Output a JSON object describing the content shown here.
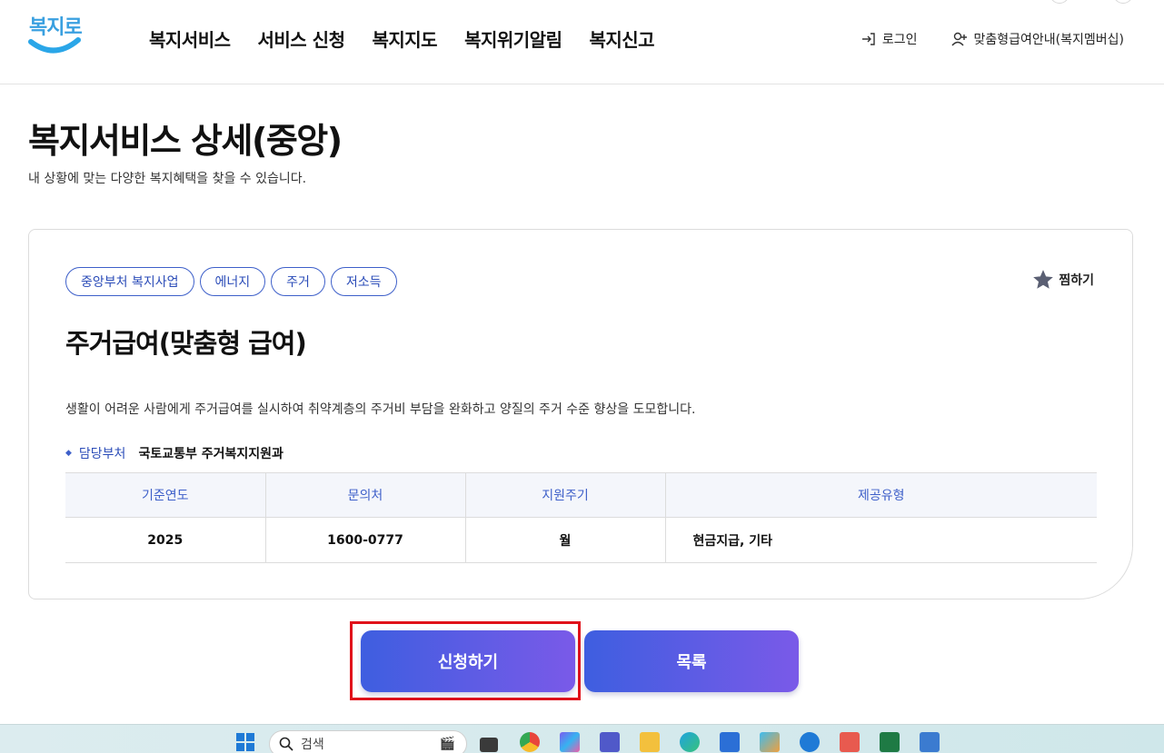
{
  "header": {
    "logo_text": "복지로",
    "nav": [
      "복지서비스",
      "서비스 신청",
      "복지지도",
      "복지위기알림",
      "복지신고"
    ],
    "login_label": "로그인",
    "membership_label": "맞춤형급여안내(복지멤버십)"
  },
  "page": {
    "title": "복지서비스 상세(중앙)",
    "subtitle": "내 상황에 맞는 다양한 복지혜택을 찾을 수 있습니다."
  },
  "service": {
    "tags": [
      "중앙부처 복지사업",
      "에너지",
      "주거",
      "저소득"
    ],
    "favorite_label": "찜하기",
    "title": "주거급여(맞춤형 급여)",
    "description": "생활이 어려운 사람에게 주거급여를 실시하여 취약계층의 주거비 부담을 완화하고 양질의 주거 수준 향상을 도모합니다.",
    "dept_label": "담당부처",
    "dept_value": "국토교통부 주거복지지원과",
    "table": {
      "headers": [
        "기준연도",
        "문의처",
        "지원주기",
        "제공유형"
      ],
      "row": [
        "2025",
        "1600-0777",
        "월",
        "현금지급, 기타"
      ]
    }
  },
  "buttons": {
    "apply": "신청하기",
    "list": "목록"
  },
  "taskbar": {
    "search_placeholder": "검색"
  },
  "colors": {
    "accent": "#3d5fc9",
    "button_start": "#3e5ee0",
    "button_end": "#7a5ae8",
    "highlight": "#e0121b"
  }
}
